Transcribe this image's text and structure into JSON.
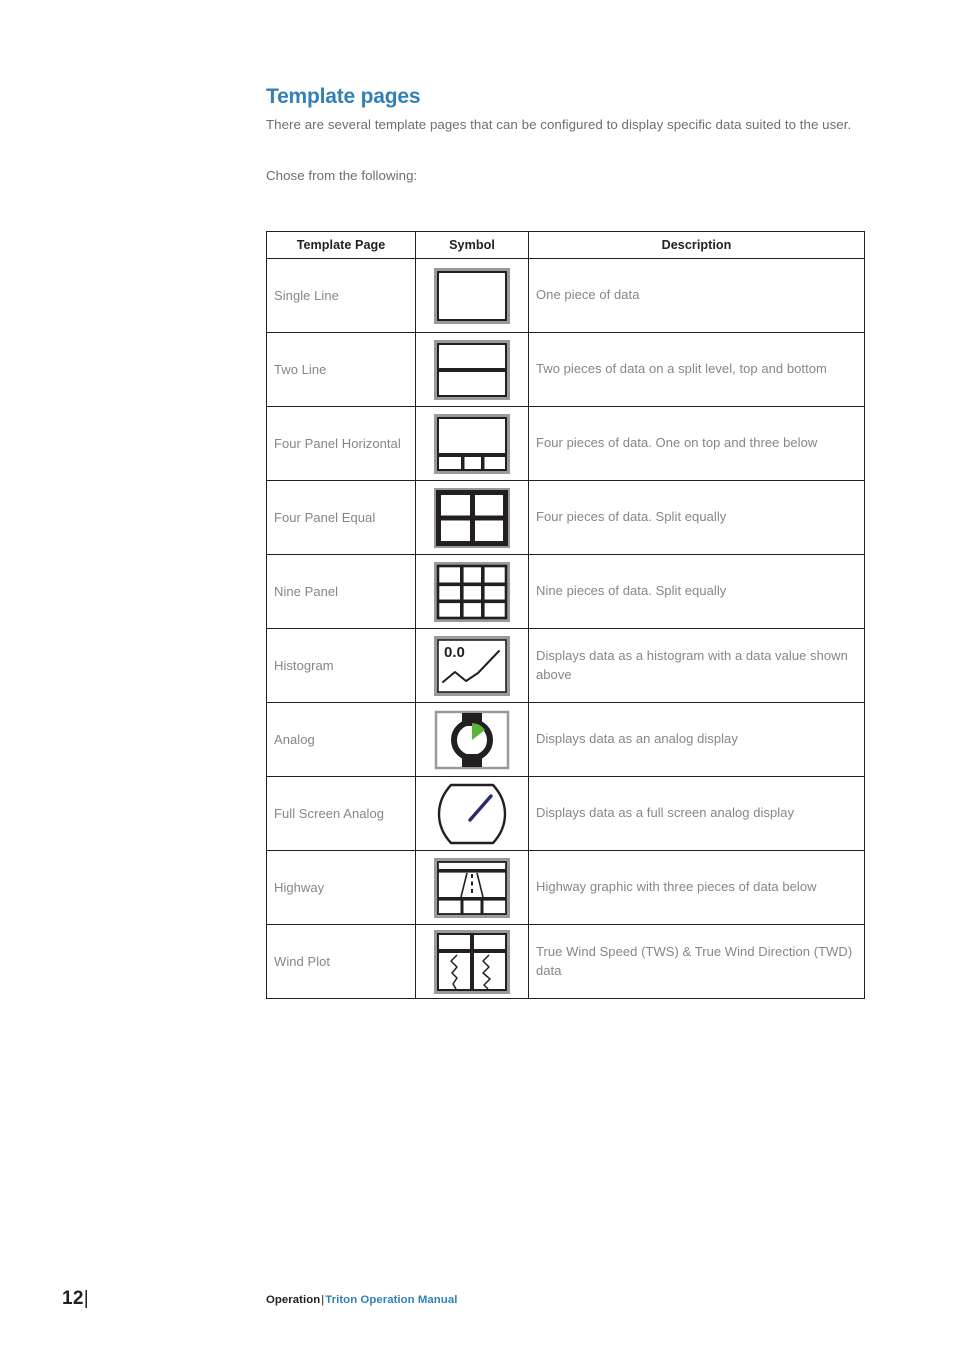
{
  "page": {
    "title": "Template pages",
    "intro": "There are several template pages that can be configured to display specific data suited to the user.",
    "intro2": "Chose from the following:",
    "accent_color": "#3380B8",
    "text_color": "#868686",
    "rule_color": "#231F20"
  },
  "table": {
    "headers": [
      "Template Page",
      "Symbol",
      "Description"
    ],
    "rows": [
      {
        "name": "Single Line",
        "symbol": "single-line-symbol",
        "description": "One piece of data"
      },
      {
        "name": "Two Line",
        "symbol": "two-line-symbol",
        "description": "Two pieces of data on a split level, top and bottom"
      },
      {
        "name": "Four Panel Horizontal",
        "symbol": "four-panel-horizontal-symbol",
        "description": "Four pieces of data. One on top and three below"
      },
      {
        "name": "Four Panel Equal",
        "symbol": "four-panel-equal-symbol",
        "description": "Four pieces of data. Split equally"
      },
      {
        "name": "Nine Panel",
        "symbol": "nine-panel-symbol",
        "description": "Nine pieces of data. Split equally"
      },
      {
        "name": "Histogram",
        "symbol": "histogram-symbol",
        "symbol_label": "0.0",
        "description": "Displays data as a histogram with a data value shown above"
      },
      {
        "name": "Analog",
        "symbol": "analog-symbol",
        "symbol_accent": "#5CB335",
        "description": "Displays data as an analog display"
      },
      {
        "name": "Full Screen Analog",
        "symbol": "full-screen-analog-symbol",
        "symbol_accent": "#2B2A6E",
        "description": "Displays data as a full screen analog display"
      },
      {
        "name": "Highway",
        "symbol": "highway-symbol",
        "description": "Highway graphic with three pieces of data below"
      },
      {
        "name": "Wind Plot",
        "symbol": "wind-plot-symbol",
        "description": "True Wind Speed (TWS) & True Wind Direction (TWD) data"
      }
    ]
  },
  "footer": {
    "page_number": "12",
    "page_number_bar": "|",
    "section": "Operation",
    "separator": "|",
    "manual": "Triton Operation Manual"
  }
}
